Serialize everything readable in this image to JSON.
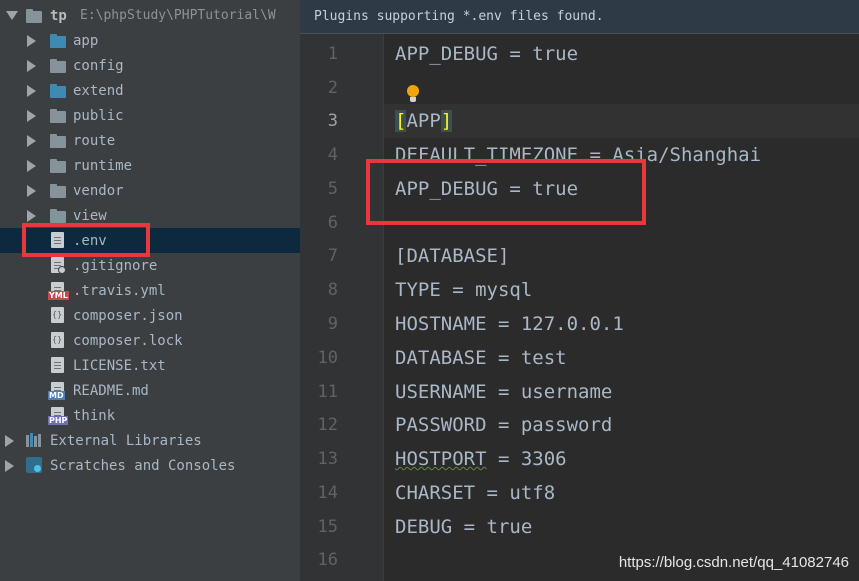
{
  "project": {
    "root_name": "tp",
    "root_path": "E:\\phpStudy\\PHPTutorial\\W",
    "folders": [
      {
        "label": "app"
      },
      {
        "label": "config"
      },
      {
        "label": "extend"
      },
      {
        "label": "public"
      },
      {
        "label": "route"
      },
      {
        "label": "runtime"
      },
      {
        "label": "vendor"
      },
      {
        "label": "view"
      }
    ],
    "files": [
      {
        "label": ".env"
      },
      {
        "label": ".gitignore"
      },
      {
        "label": ".travis.yml",
        "badge": "YML"
      },
      {
        "label": "composer.json"
      },
      {
        "label": "composer.lock"
      },
      {
        "label": "LICENSE.txt"
      },
      {
        "label": "README.md",
        "badge": "MD"
      },
      {
        "label": "think",
        "badge": "PHP"
      }
    ],
    "external_libraries": "External Libraries",
    "scratches": "Scratches and Consoles"
  },
  "editor": {
    "banner": "Plugins supporting *.env files found.",
    "line_numbers": [
      "1",
      "2",
      "3",
      "4",
      "5",
      "6",
      "7",
      "8",
      "9",
      "10",
      "11",
      "12",
      "13",
      "14",
      "15",
      "16"
    ],
    "current_line": "3",
    "lines": {
      "l1": "APP_DEBUG = true",
      "l2": "",
      "l3_open": "[",
      "l3_name": "APP",
      "l3_close": "]",
      "l4": "DEFAULT_TIMEZONE = Asia/Shanghai",
      "l5": "APP_DEBUG = true",
      "l6": "",
      "l7": "[DATABASE]",
      "l8": "TYPE = mysql",
      "l9": "HOSTNAME = 127.0.0.1",
      "l10": "DATABASE = test",
      "l11": "USERNAME = username",
      "l12": "PASSWORD = password",
      "l13_key": "HOSTPORT",
      "l13_rest": " = 3306",
      "l14": "CHARSET = utf8",
      "l15": "DEBUG = true",
      "l16": ""
    }
  },
  "watermark": "https://blog.csdn.net/qq_41082746",
  "colors": {
    "highlight_box": "#e8383c",
    "selection": "#0d293e",
    "bulb": "#f0a30a"
  }
}
